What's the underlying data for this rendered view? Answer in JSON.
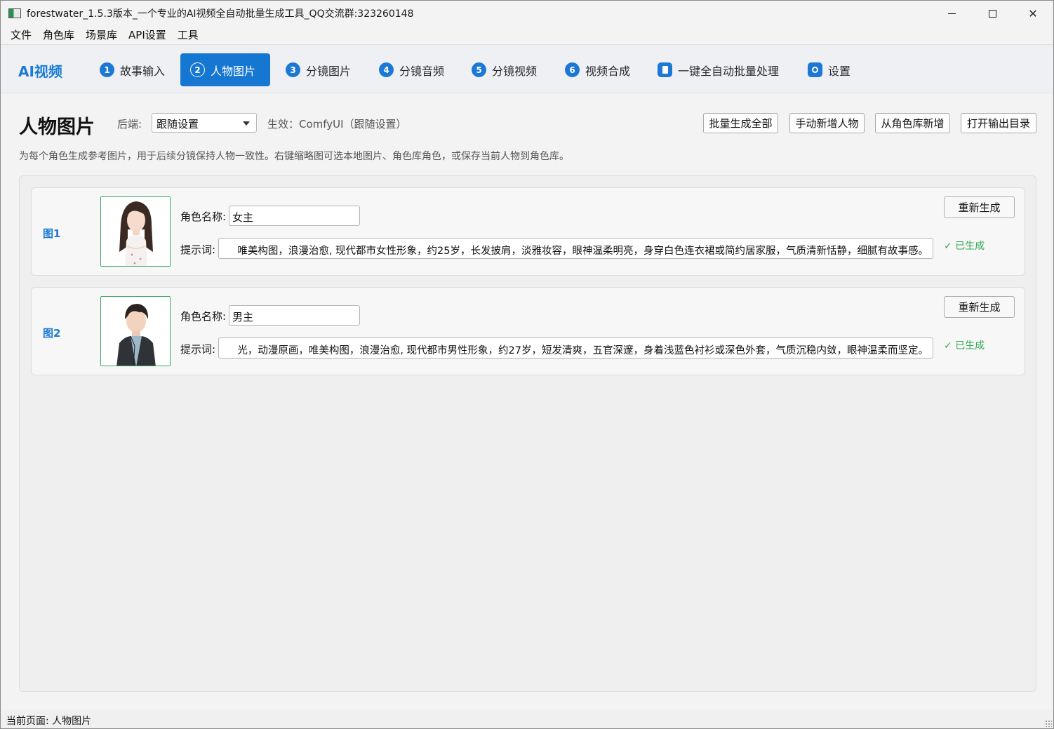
{
  "window": {
    "title": "forestwater_1.5.3版本_一个专业的AI视频全自动批量生成工具_QQ交流群:323260148",
    "close_glyph": "✕"
  },
  "menu": [
    "文件",
    "角色库",
    "场景库",
    "API设置",
    "工具"
  ],
  "nav": {
    "brand": "AI视频",
    "tabs": [
      {
        "num": "1",
        "label": "故事输入"
      },
      {
        "num": "2",
        "label": "人物图片"
      },
      {
        "num": "3",
        "label": "分镜图片"
      },
      {
        "num": "4",
        "label": "分镜音频"
      },
      {
        "num": "5",
        "label": "分镜视频"
      },
      {
        "num": "6",
        "label": "视频合成"
      },
      {
        "icon": "document-icon",
        "label": "一键全自动批量处理"
      },
      {
        "icon": "gear-icon",
        "label": "设置"
      }
    ],
    "active_index": 1
  },
  "header": {
    "title": "人物图片",
    "backend_label": "后端:",
    "backend_value": "跟随设置",
    "effective_text": "生效：ComfyUI（跟随设置）",
    "buttons": [
      "批量生成全部",
      "手动新增人物",
      "从角色库新增",
      "打开输出目录"
    ],
    "subtitle": "为每个角色生成参考图片，用于后续分镜保持人物一致性。右键缩略图可选本地图片、角色库角色，或保存当前人物到角色库。"
  },
  "cards": [
    {
      "label": "图1",
      "name_label": "角色名称:",
      "name_value": "女主",
      "prompt_label": "提示词:",
      "prompt_value": "唯美构图，浪漫治愈, 现代都市女性形象，约25岁，长发披肩，淡雅妆容，眼神温柔明亮，身穿白色连衣裙或简约居家服，气质清新恬静，细腻有故事感。",
      "regen_label": "重新生成",
      "status": "✓ 已生成"
    },
    {
      "label": "图2",
      "name_label": "角色名称:",
      "name_value": "男主",
      "prompt_label": "提示词:",
      "prompt_value": "光，动漫原画，唯美构图，浪漫治愈, 现代都市男性形象，约27岁，短发清爽，五官深邃，身着浅蓝色衬衫或深色外套，气质沉稳内敛，眼神温柔而坚定。",
      "regen_label": "重新生成",
      "status": "✓ 已生成"
    }
  ],
  "statusbar": {
    "text": "当前页面: 人物图片"
  },
  "colors": {
    "accent": "#1677d2",
    "success": "#34a853",
    "brand": "#1a7bd3"
  }
}
